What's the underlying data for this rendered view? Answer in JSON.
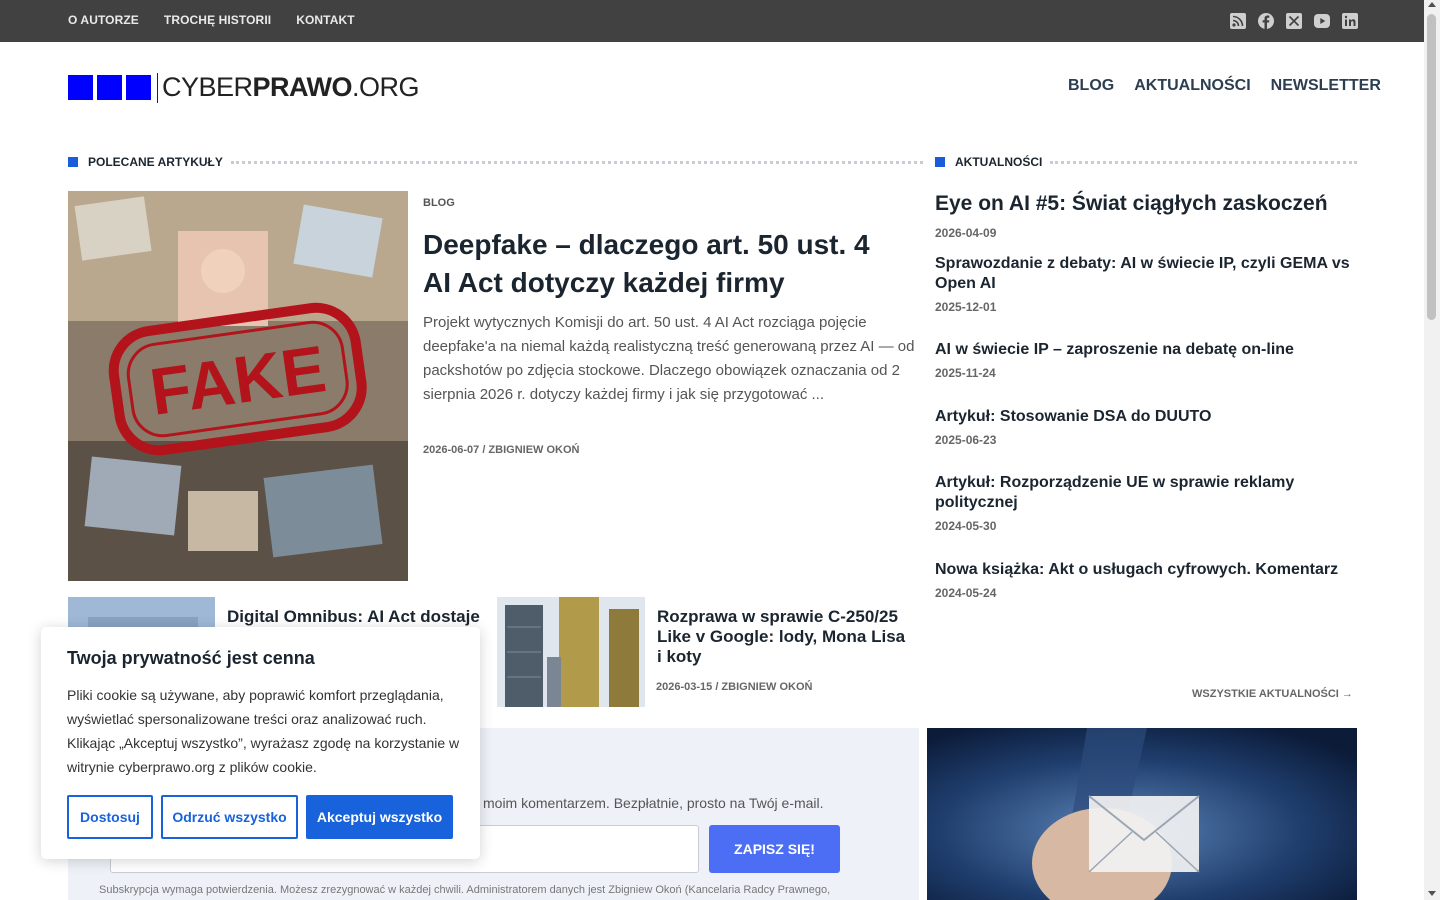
{
  "topbar": {
    "links": [
      "O AUTORZE",
      "TROCHĘ HISTORII",
      "KONTAKT"
    ],
    "social_icons": [
      "rss-icon",
      "facebook-icon",
      "x-icon",
      "youtube-icon",
      "linkedin-icon"
    ]
  },
  "logo": {
    "light": "CYBER",
    "bold": "PRAWO",
    "tld": ".ORG"
  },
  "mainnav": [
    "BLOG",
    "AKTUALNOŚCI",
    "NEWSLETTER"
  ],
  "featured": {
    "section_title": "POLECANE ARTYKUŁY",
    "category": "BLOG",
    "title": "Deepfake – dlaczego art. 50 ust. 4 AI Act dotyczy każdej firmy",
    "excerpt": "Projekt wytycznych Komisji do art. 50 ust. 4 AI Act rozciąga pojęcie deepfake'a na niemal każdą realistyczną treść generowaną przez AI — od packshotów po zdjęcia stockowe. Dlaczego obowiązek oznaczania od 2 sierpnia 2026 r. dotyczy każdej firmy i jak się przygotować ...",
    "meta": "2026-06-07 / ZBIGNIEW OKOŃ",
    "image_label": "FAKE"
  },
  "small_articles": [
    {
      "title": "Digital Omnibus: AI Act dostaje",
      "meta": ""
    },
    {
      "title": "Rozprawa w sprawie C-250/25 Like v Google: lody, Mona Lisa i koty",
      "meta": "2026-03-15 / ZBIGNIEW OKOŃ"
    }
  ],
  "news": {
    "section_title": "AKTUALNOŚCI",
    "items": [
      {
        "title": "Eye on AI #5: Świat ciągłych zaskoczeń",
        "date": "2026-04-09"
      },
      {
        "title": "Sprawozdanie z debaty: AI w świecie IP, czyli GEMA vs Open AI",
        "date": "2025-12-01"
      },
      {
        "title": "AI w świecie IP – zaproszenie na debatę on-line",
        "date": "2025-11-24"
      },
      {
        "title": "Artykuł: Stosowanie DSA do DUUTO",
        "date": "2025-06-23"
      },
      {
        "title": "Artykuł: Rozporządzenie UE w sprawie reklamy politycznej",
        "date": "2024-05-30"
      },
      {
        "title": "Nowa książka: Akt o usługach cyfrowych. Komentarz",
        "date": "2024-05-24"
      }
    ],
    "all_link": "WSZYSTKIE AKTUALNOŚCI →"
  },
  "newsletter": {
    "text_visible": "moim komentarzem. Bezpłatnie, prosto na Twój e-mail.",
    "email_value": "",
    "button": "ZAPISZ SIĘ!",
    "fine_print": "Subskrypcja wymaga potwierdzenia. Możesz zrezygnować w każdej chwili. Administratorem danych jest Zbigniew Okoń (Kancelaria Radcy Prawnego,"
  },
  "cookie": {
    "title": "Twoja prywatność jest cenna",
    "body": "Pliki cookie są używane, aby poprawić komfort przeglądania, wyświetlać spersonalizowane treści oraz analizować ruch. Klikając „Akceptuj wszystko”, wyrażasz zgodę na korzystanie w witrynie cyberprawo.org z plików cookie.",
    "customize": "Dostosuj",
    "reject": "Odrzuć wszystko",
    "accept": "Akceptuj wszystko"
  },
  "colors": {
    "accent": "#1a5ddc",
    "logo_blue": "#0000ff",
    "topbar": "#414141",
    "button": "#4c6ef5"
  }
}
